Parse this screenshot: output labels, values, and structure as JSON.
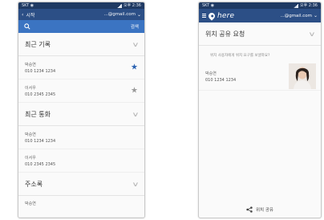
{
  "left": {
    "status": {
      "left": "SKT ◉",
      "right": "오후 2:36"
    },
    "appbar": {
      "back": "‹",
      "title": "시작",
      "account": "...@gmail.com",
      "chevron": "⌄"
    },
    "search": {
      "icon": "search-icon",
      "go_label": "검색"
    },
    "sections": [
      {
        "label": "최근 기록",
        "entries": [
          {
            "name": "박승연",
            "number": "010 1234 1234",
            "starred": true
          },
          {
            "name": "이서우",
            "number": "010 2345 2345",
            "starred": false
          }
        ]
      },
      {
        "label": "최근 통화",
        "entries": [
          {
            "name": "박승연",
            "number": "010 1234 1234"
          },
          {
            "name": "이서우",
            "number": "010 2345 2345"
          }
        ]
      },
      {
        "label": "주소록",
        "entries": [
          {
            "name": "박승연",
            "number": ""
          }
        ]
      }
    ]
  },
  "right": {
    "status": {
      "left": "SKT ◉",
      "right": "오후 2:36"
    },
    "appbar": {
      "brand": "here",
      "account": "...@gmail.com",
      "chevron": "⌄"
    },
    "section": {
      "label": "위치 공유 요청"
    },
    "hint": "위치 사용자에게 위치 요구를 보낼까요?",
    "contact": {
      "name": "박승연",
      "number": "010 1234 1234"
    },
    "share": {
      "label": "위치 공유"
    }
  },
  "colors": {
    "appbar": "#2c4f86",
    "search": "#3b74c2",
    "star_on": "#2d64b3"
  }
}
